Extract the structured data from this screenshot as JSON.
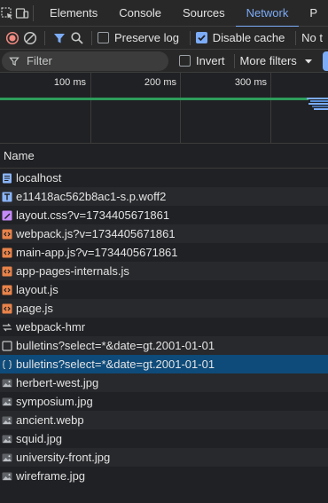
{
  "tabs": [
    "Elements",
    "Console",
    "Sources",
    "Network",
    "P"
  ],
  "active_tab": "Network",
  "toolbar": {
    "preserve_log_label": "Preserve log",
    "preserve_log_checked": false,
    "disable_cache_label": "Disable cache",
    "disable_cache_checked": true,
    "throttle_label": "No t"
  },
  "filter": {
    "placeholder": "Filter",
    "invert_label": "Invert",
    "more_filters_label": "More filters"
  },
  "timeline": {
    "ticks": [
      "100 ms",
      "200 ms",
      "300 ms"
    ]
  },
  "table": {
    "name_header": "Name"
  },
  "requests": [
    {
      "name": "localhost",
      "icon": "document-icon"
    },
    {
      "name": "e11418ac562b8ac1-s.p.woff2",
      "icon": "font-icon"
    },
    {
      "name": "layout.css?v=1734405671861",
      "icon": "stylesheet-icon"
    },
    {
      "name": "webpack.js?v=1734405671861",
      "icon": "script-icon"
    },
    {
      "name": "main-app.js?v=1734405671861",
      "icon": "script-icon"
    },
    {
      "name": "app-pages-internals.js",
      "icon": "script-icon"
    },
    {
      "name": "layout.js",
      "icon": "script-icon"
    },
    {
      "name": "page.js",
      "icon": "script-icon"
    },
    {
      "name": "webpack-hmr",
      "icon": "websocket-icon"
    },
    {
      "name": "bulletins?select=*&date=gt.2001-01-01",
      "icon": "other-icon"
    },
    {
      "name": "bulletins?select=*&date=gt.2001-01-01",
      "icon": "fetch-icon"
    },
    {
      "name": "herbert-west.jpg",
      "icon": "image-icon"
    },
    {
      "name": "symposium.jpg",
      "icon": "image-icon"
    },
    {
      "name": "ancient.webp",
      "icon": "image-icon"
    },
    {
      "name": "squid.jpg",
      "icon": "image-icon"
    },
    {
      "name": "university-front.jpg",
      "icon": "image-icon"
    },
    {
      "name": "wireframe.jpg",
      "icon": "image-icon"
    }
  ],
  "selected_request": 10,
  "colors": {
    "accent": "#7cacf8",
    "record": "#f28b82",
    "script": "#e8834a",
    "stylesheet": "#c58af9",
    "selection": "#0e4b7a",
    "timeline_green": "#2d9d5c"
  }
}
